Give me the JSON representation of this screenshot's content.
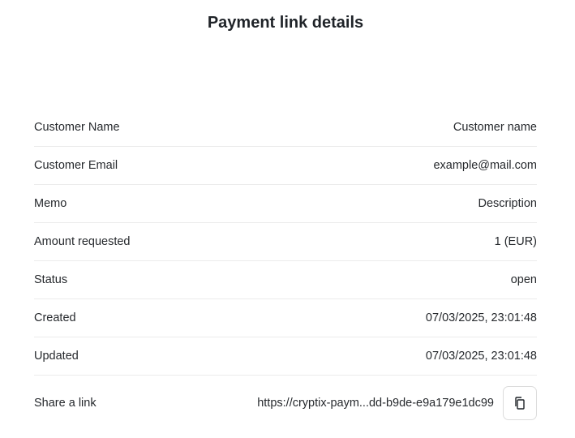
{
  "page": {
    "title": "Payment link details"
  },
  "details": [
    {
      "label": "Customer Name",
      "value": "Customer name"
    },
    {
      "label": "Customer Email",
      "value": "example@mail.com"
    },
    {
      "label": "Memo",
      "value": "Description"
    },
    {
      "label": "Amount requested",
      "value": "1 (EUR)"
    },
    {
      "label": "Status",
      "value": "open"
    },
    {
      "label": "Created",
      "value": "07/03/2025, 23:01:48"
    },
    {
      "label": "Updated",
      "value": "07/03/2025, 23:01:48"
    }
  ],
  "share": {
    "label": "Share a link",
    "link": "https://cryptix-paym...dd-b9de-e9a179e1dc99",
    "copy_icon": "copy-icon"
  }
}
